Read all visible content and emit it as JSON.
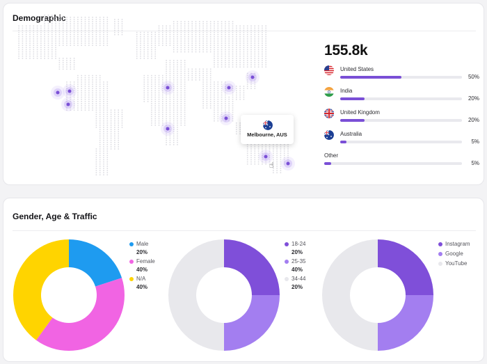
{
  "demographic": {
    "title": "Demographic",
    "total": "155.8k",
    "tooltip": "Melbourne, AUS",
    "countries": [
      {
        "name": "United States",
        "percent": "50%",
        "fraction": 0.5,
        "flag": "flag-us-icon"
      },
      {
        "name": "India",
        "percent": "20%",
        "fraction": 0.2,
        "flag": "flag-india-icon"
      },
      {
        "name": "United Kingdom",
        "percent": "20%",
        "fraction": 0.2,
        "flag": "flag-uk-icon"
      },
      {
        "name": "Australia",
        "percent": "5%",
        "fraction": 0.05,
        "flag": "flag-australia-icon"
      }
    ],
    "other": {
      "name": "Other",
      "percent": "5%",
      "fraction": 0.05
    }
  },
  "gat": {
    "title": "Gender, Age & Traffic",
    "gender": {
      "items": [
        {
          "label": "Male",
          "value": "20%",
          "color": "#1e9bf0"
        },
        {
          "label": "Female",
          "value": "40%",
          "color": "#f164e3"
        },
        {
          "label": "N/A",
          "value": "40%",
          "color": "#ffd400"
        }
      ]
    },
    "age": {
      "items": [
        {
          "label": "18-24",
          "value": "20%",
          "color": "#7f4fd9"
        },
        {
          "label": "25-35",
          "value": "40%",
          "color": "#a37ef0"
        },
        {
          "label": "34-44",
          "value": "20%",
          "color": "#e8e8ec"
        }
      ]
    },
    "traffic": {
      "items": [
        {
          "label": "Instagram",
          "color": "#7f4fd9"
        },
        {
          "label": "Google",
          "color": "#a37ef0"
        },
        {
          "label": "YouTube",
          "color": "#e8e8ec"
        }
      ]
    }
  },
  "chart_data": [
    {
      "type": "pie",
      "categories": [
        "Male",
        "Female",
        "N/A"
      ],
      "values": [
        20,
        40,
        40
      ]
    },
    {
      "type": "pie",
      "categories": [
        "18-24",
        "25-35",
        "34-44"
      ],
      "values": [
        25,
        25,
        50
      ]
    },
    {
      "type": "pie",
      "categories": [
        "Instagram",
        "Google",
        "YouTube"
      ],
      "values": [
        25,
        25,
        50
      ]
    }
  ]
}
